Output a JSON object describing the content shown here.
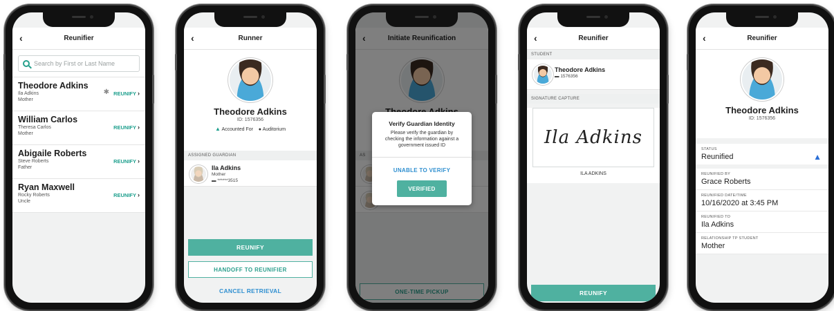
{
  "phone1": {
    "title": "Reunifier",
    "search_placeholder": "Search by First or Last Name",
    "rows": [
      {
        "name": "Theodore Adkins",
        "guardian": "Ila Adkins",
        "relation": "Mother",
        "action": "REUNIFY"
      },
      {
        "name": "William Carlos",
        "guardian": "Theresa Carlos",
        "relation": "Mother",
        "action": "REUNIFY"
      },
      {
        "name": "Abigaile Roberts",
        "guardian": "Steve Roberts",
        "relation": "Father",
        "action": "REUNIFY"
      },
      {
        "name": "Ryan Maxwell",
        "guardian": "Rocky Roberts",
        "relation": "Uncle",
        "action": "REUNIFY"
      }
    ]
  },
  "phone2": {
    "title": "Runner",
    "student_name": "Theodore Adkins",
    "student_id": "ID: 1576356",
    "status": "Accounted For",
    "location": "Auditorium",
    "guardian_header": "ASSIGNED GUARDIAN",
    "guardian_name": "Ila Adkins",
    "guardian_relation": "Mother",
    "guardian_id": "******3515",
    "reunify_label": "REUNIFY",
    "handoff_label": "HANDOFF TO REUNIFIER",
    "cancel_label": "CANCEL RETRIEVAL"
  },
  "phone3": {
    "title": "Initiate Reunification",
    "student_name": "Theodore Adkins",
    "section_abbr": "AS",
    "modal_title": "Verify Guardian Identity",
    "modal_body": "Please verify the guardian by checking the information against a government issued ID",
    "unable_label": "UNABLE TO VERIFY",
    "verified_label": "VERIFIED",
    "pickup_label": "ONE-TIME PICKUP"
  },
  "phone4": {
    "title": "Reunifier",
    "student_header": "STUDENT",
    "student_name": "Theodore Adkins",
    "student_id": "1576356",
    "signature_header": "SIGNATURE CAPTURE",
    "signature": "Ila Adkins",
    "signer_label": "ILA ADKINS",
    "reunify_label": "REUNIFY"
  },
  "phone5": {
    "title": "Reunifier",
    "student_name": "Theodore Adkins",
    "student_id": "ID: 1576356",
    "status_label": "STATUS",
    "status_value": "Reunified",
    "fields": [
      {
        "label": "REUNIFIED BY",
        "value": "Grace Roberts"
      },
      {
        "label": "REUNIFIED DATE/TIME",
        "value": "10/16/2020 at 3:45 PM"
      },
      {
        "label": "REUNIFIED TO",
        "value": "Ila Adkins"
      },
      {
        "label": "RELATIONSHIP TP STUDENT",
        "value": "Mother"
      }
    ]
  },
  "colors": {
    "teal": "#4fb1a0",
    "link_blue": "#2f8fd0",
    "status_blue": "#2b6fd6"
  },
  "icons": [
    "back-chevron-icon",
    "search-icon",
    "chevron-right-icon",
    "triangle-icon",
    "location-pin-icon",
    "id-card-icon",
    "alert-triangle-icon"
  ]
}
